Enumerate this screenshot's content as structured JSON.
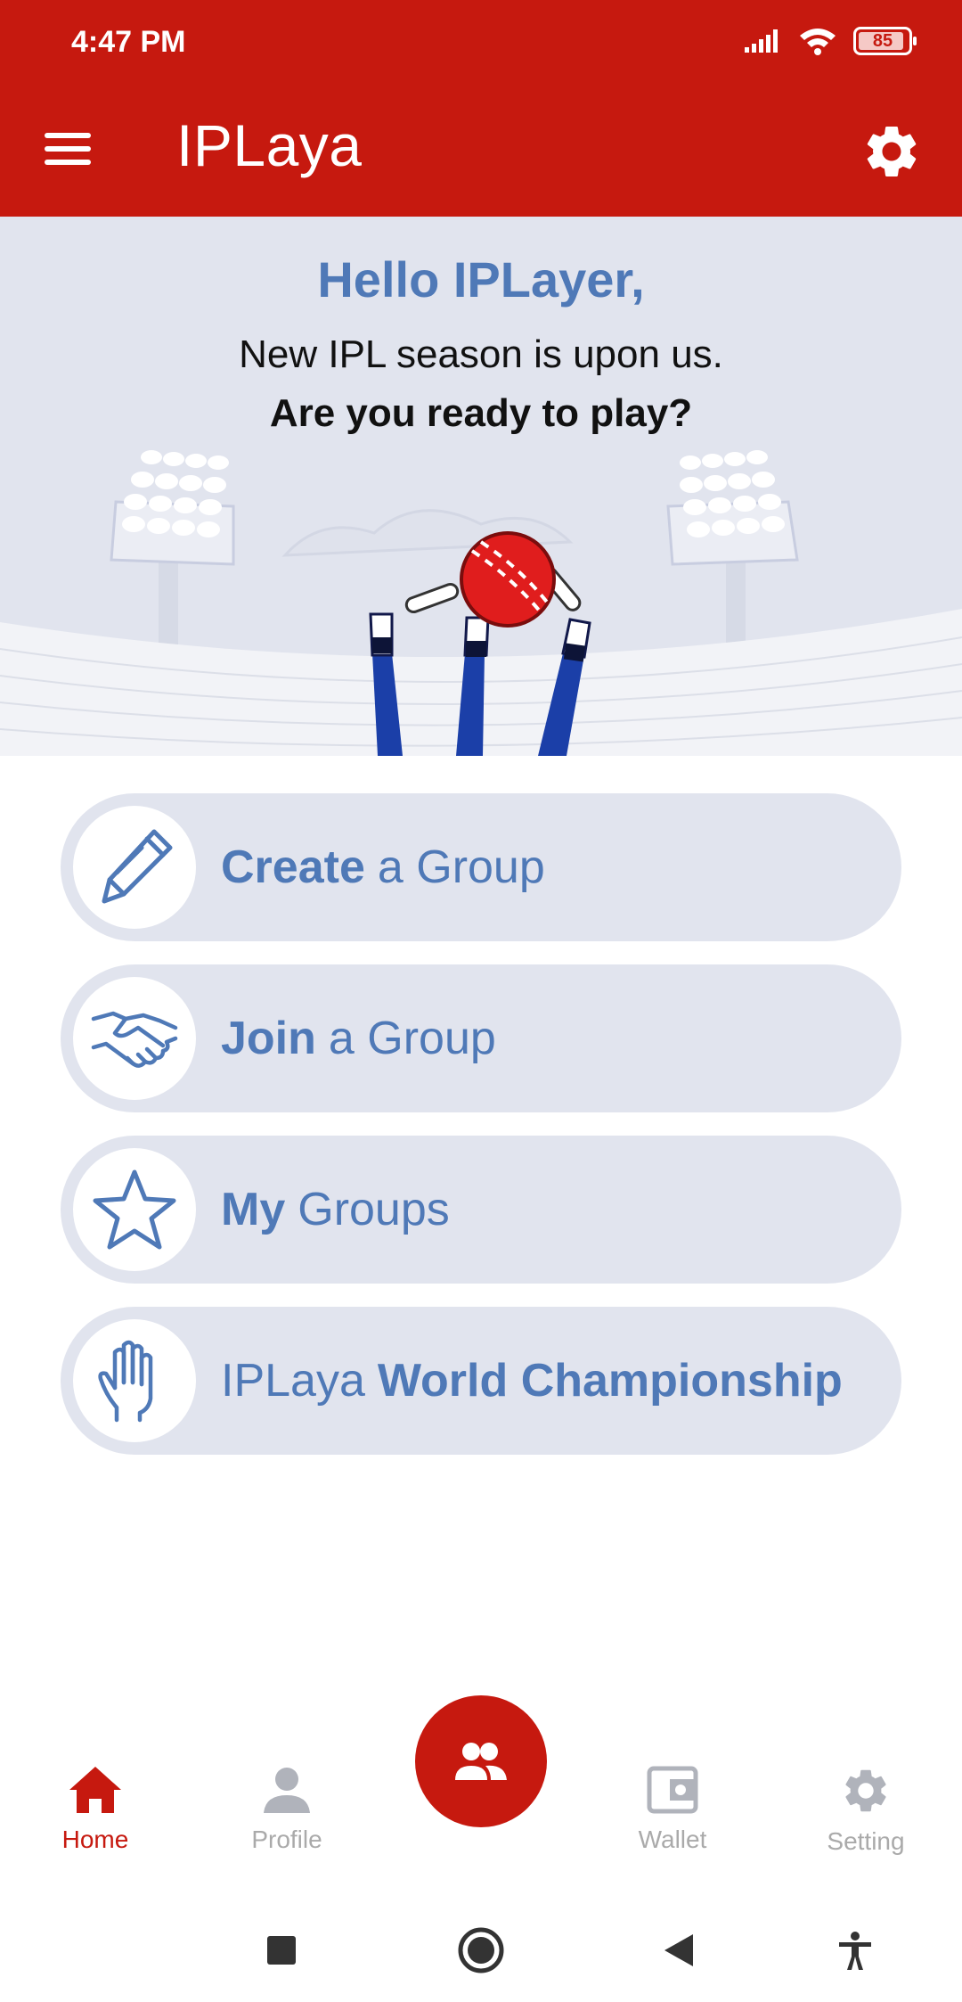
{
  "status_bar": {
    "time": "4:47 PM",
    "battery": "85"
  },
  "app_bar": {
    "title": "IPLaya",
    "menu_icon": "hamburger-icon",
    "settings_icon": "gear-icon"
  },
  "hero": {
    "greeting": "Hello IPLayer,",
    "line1": "New IPL season is upon us.",
    "line2": "Are you ready to play?"
  },
  "menu": [
    {
      "icon": "pencil-icon",
      "bold": "Create",
      "rest": "a Group"
    },
    {
      "icon": "handshake-icon",
      "bold": "Join",
      "rest": "a Group"
    },
    {
      "icon": "star-icon",
      "bold": "My",
      "rest": "Groups"
    },
    {
      "icon": "hand-icon",
      "prefix": "IPLaya",
      "bold": "World Championship"
    }
  ],
  "bottom_nav": {
    "items": [
      {
        "label": "Home",
        "icon": "home-icon",
        "active": true
      },
      {
        "label": "Profile",
        "icon": "person-icon"
      },
      {
        "label": "Wallet",
        "icon": "wallet-icon"
      },
      {
        "label": "Setting",
        "icon": "gear-icon"
      }
    ],
    "fab_icon": "group-icon"
  },
  "colors": {
    "brand": "#c6190f",
    "accent": "#4f79b7",
    "card": "#e1e4ee",
    "inactive": "#aaaaaa"
  }
}
